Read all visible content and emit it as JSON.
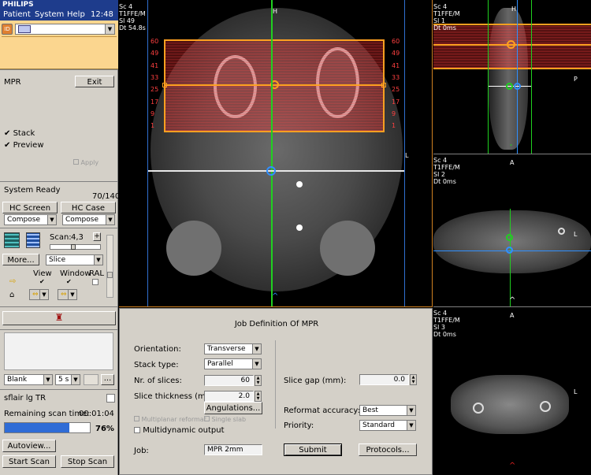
{
  "app": {
    "brand": "PHILIPS",
    "clock": "12:48"
  },
  "menu": [
    "Patient",
    "System",
    "Help"
  ],
  "mpr": {
    "title": "MPR",
    "exit_label": "Exit",
    "stack_label": "Stack",
    "preview_label": "Preview",
    "disabled_check_label": "Apply"
  },
  "status": {
    "text": "System Ready",
    "count": "70/140"
  },
  "hc": {
    "screen_label": "HC Screen",
    "case_label": "HC Case",
    "screen_mode": "Compose",
    "case_mode": "Compose"
  },
  "viewer_tools": {
    "scan_label": "Scan:",
    "scan_value": "4,3",
    "more_label": "More...",
    "mode_value": "Slice",
    "view_label": "View",
    "window_label": "Window",
    "ral_label": "RAL"
  },
  "film": {
    "layout_value": "Blank",
    "interval_value": "5 s",
    "dots_label": "..."
  },
  "scan": {
    "name": "sflair lg TR",
    "remaining_label": "Remaining scan time:",
    "remaining_value": "00:01:04",
    "progress_text": "76%",
    "progress": 0.76,
    "autoview_label": "Autoview...",
    "start_label": "Start Scan",
    "stop_label": "Stop Scan"
  },
  "main_view": {
    "overlay": "Sc 4\nT1FFE/M\nSl 49\nDt 54.8s",
    "top_marker": "H",
    "side_marker": "L",
    "slice_numbers": [
      "60",
      "49",
      "41",
      "33",
      "25",
      "17",
      "9",
      "1"
    ]
  },
  "side_top": {
    "overlay": "Sc 4\nT1FFE/M\nSl 1\nDt 0ms",
    "top_marker": "H",
    "side_marker": "P",
    "bottom_marker": "A"
  },
  "side_mid": {
    "overlay": "Sc 4\nT1FFE/M\nSl 2\nDt 0ms",
    "side_marker": "L",
    "bottom_marker": "A"
  },
  "side_bot": {
    "overlay": "Sc 4\nT1FFE/M\nSl 3\nDt 0ms",
    "side_marker": "L"
  },
  "job": {
    "title": "Job Definition Of MPR",
    "orientation_label": "Orientation:",
    "orientation_value": "Transverse",
    "stack_type_label": "Stack type:",
    "stack_type_value": "Parallel",
    "nr_slices_label": "Nr. of slices:",
    "nr_slices_value": "60",
    "thickness_label": "Slice thickness (mm):",
    "thickness_value": "2.0",
    "angulations_label": "Angulations...",
    "disabled_opt1": "Multiplanar reformat",
    "disabled_opt2": "Single slab",
    "multidynamic_label": "Multidynamic output",
    "gap_label": "Slice gap (mm):",
    "gap_value": "0.0",
    "accuracy_label": "Reformat accuracy:",
    "accuracy_value": "Best",
    "priority_label": "Priority:",
    "priority_value": "Standard",
    "job_label": "Job:",
    "job_value": "MPR 2mm",
    "submit_label": "Submit",
    "protocols_label": "Protocols..."
  },
  "colors": {
    "brand_blue": "#1e3c8c",
    "orange_panel": "#fbd68f",
    "stack_line": "#ff4040",
    "box_orange": "#ffa020",
    "green_line": "#20d020",
    "blue_line": "#3090ff"
  }
}
